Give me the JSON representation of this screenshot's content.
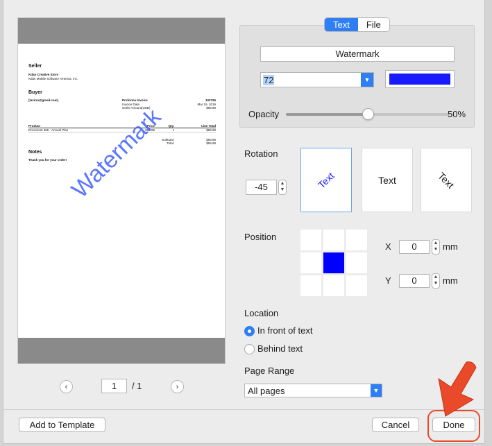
{
  "preview": {
    "seller_heading": "Seller",
    "seller_name": "Kdan Creative Store",
    "seller_company": "Kdan Mobile Software America, Inc.",
    "buyer_heading": "Buyer",
    "buyer_email": "(lavirra@gmail.com)",
    "invoice_title": "Proforma Invoice",
    "invoice_number": "102726",
    "invoice_date_label": "Invoice Date",
    "invoice_date": "Mar 19, 2019",
    "order_amount_label": "Order Amount(USD)",
    "order_amount": "$59.99",
    "table_headers": [
      "Product",
      "Price",
      "Qty.",
      "Line Total"
    ],
    "table_rows": [
      [
        "Document 365 - Annual Plan",
        "$59.99",
        "1",
        "$59.99"
      ]
    ],
    "subtotal_label": "Subtotal:",
    "subtotal": "$59.99",
    "total_label": "Total:",
    "total": "$59.99",
    "notes_heading": "Notes",
    "notes_text": "Thank you for your order!",
    "watermark_text": "Watermark"
  },
  "pager": {
    "prev_icon": "chevron-left-icon",
    "next_icon": "chevron-right-icon",
    "current_page": "1",
    "total_pages": "/ 1"
  },
  "tabs": [
    "Text",
    "File"
  ],
  "active_tab": "Text",
  "text_settings": {
    "watermark_value": "Watermark",
    "font_size": "72",
    "color": "#1a1aff",
    "opacity_label": "Opacity",
    "opacity_value": "50%",
    "opacity_fraction": 0.5
  },
  "rotation": {
    "label": "Rotation",
    "value": "-45",
    "options": [
      "Text",
      "Text",
      "Text"
    ],
    "selected_index": 0
  },
  "position": {
    "label": "Position",
    "selected_cell": 4,
    "x_label": "X",
    "x_value": "0",
    "y_label": "Y",
    "y_value": "0",
    "unit": "mm"
  },
  "location": {
    "label": "Location",
    "options": [
      "In front of text",
      "Behind text"
    ],
    "selected": "In front of text"
  },
  "page_range": {
    "label": "Page Range",
    "value": "All pages"
  },
  "footer": {
    "add_template": "Add to Template",
    "cancel": "Cancel",
    "done": "Done"
  }
}
